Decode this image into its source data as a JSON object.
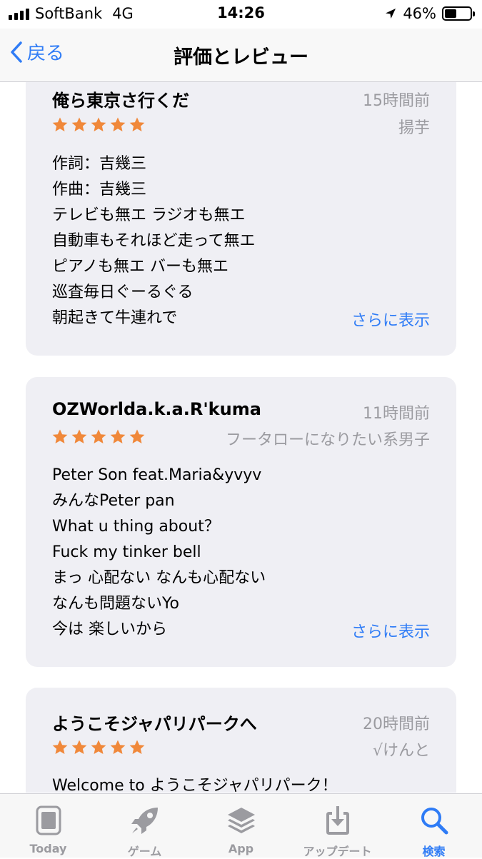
{
  "status": {
    "carrier": "SoftBank",
    "network": "4G",
    "time": "14:26",
    "battery": "46%",
    "battery_level": 0.46
  },
  "nav": {
    "back_label": "戻る",
    "title": "評価とレビュー"
  },
  "reviews": [
    {
      "title": "俺ら東京さ行くだ",
      "time": "15時間前",
      "author": "揚芋",
      "rating": 5,
      "lines": [
        "作詞：吉幾三",
        "作曲：吉幾三",
        "テレビも無エ ラジオも無エ",
        "自動車もそれほど走って無エ",
        "ピアノも無エ バーも無エ",
        "巡査毎日ぐーるぐる",
        "朝起きて牛連れで"
      ],
      "more": "さらに表示"
    },
    {
      "title": "OZWorlda.k.a.R'kuma",
      "time": "11時間前",
      "author": "フータローになりたい系男子",
      "rating": 5,
      "lines": [
        "Peter Son feat.Maria&yvyv",
        "みんなPeter pan",
        "What u thing about？",
        "Fuck my tinker bell",
        "まっ 心配ない なんも心配ない",
        "なんも問題ないYo",
        "今は 楽しいから"
      ],
      "more": "さらに表示"
    },
    {
      "title": "ようこそジャパリパークへ",
      "time": "20時間前",
      "author": "√けんと",
      "rating": 5,
      "lines": [
        "Welcome to ようこそジャパリパーク！"
      ]
    }
  ],
  "tabs": [
    {
      "label": "Today",
      "icon": "today-icon",
      "active": false
    },
    {
      "label": "ゲーム",
      "icon": "rocket-icon",
      "active": false
    },
    {
      "label": "App",
      "icon": "layers-icon",
      "active": false
    },
    {
      "label": "アップデート",
      "icon": "download-icon",
      "active": false
    },
    {
      "label": "検索",
      "icon": "search-icon",
      "active": true
    }
  ],
  "colors": {
    "accent": "#2f7cf6",
    "star": "#f0883a",
    "card_bg": "#efeff4",
    "muted": "#9b9ba0"
  }
}
